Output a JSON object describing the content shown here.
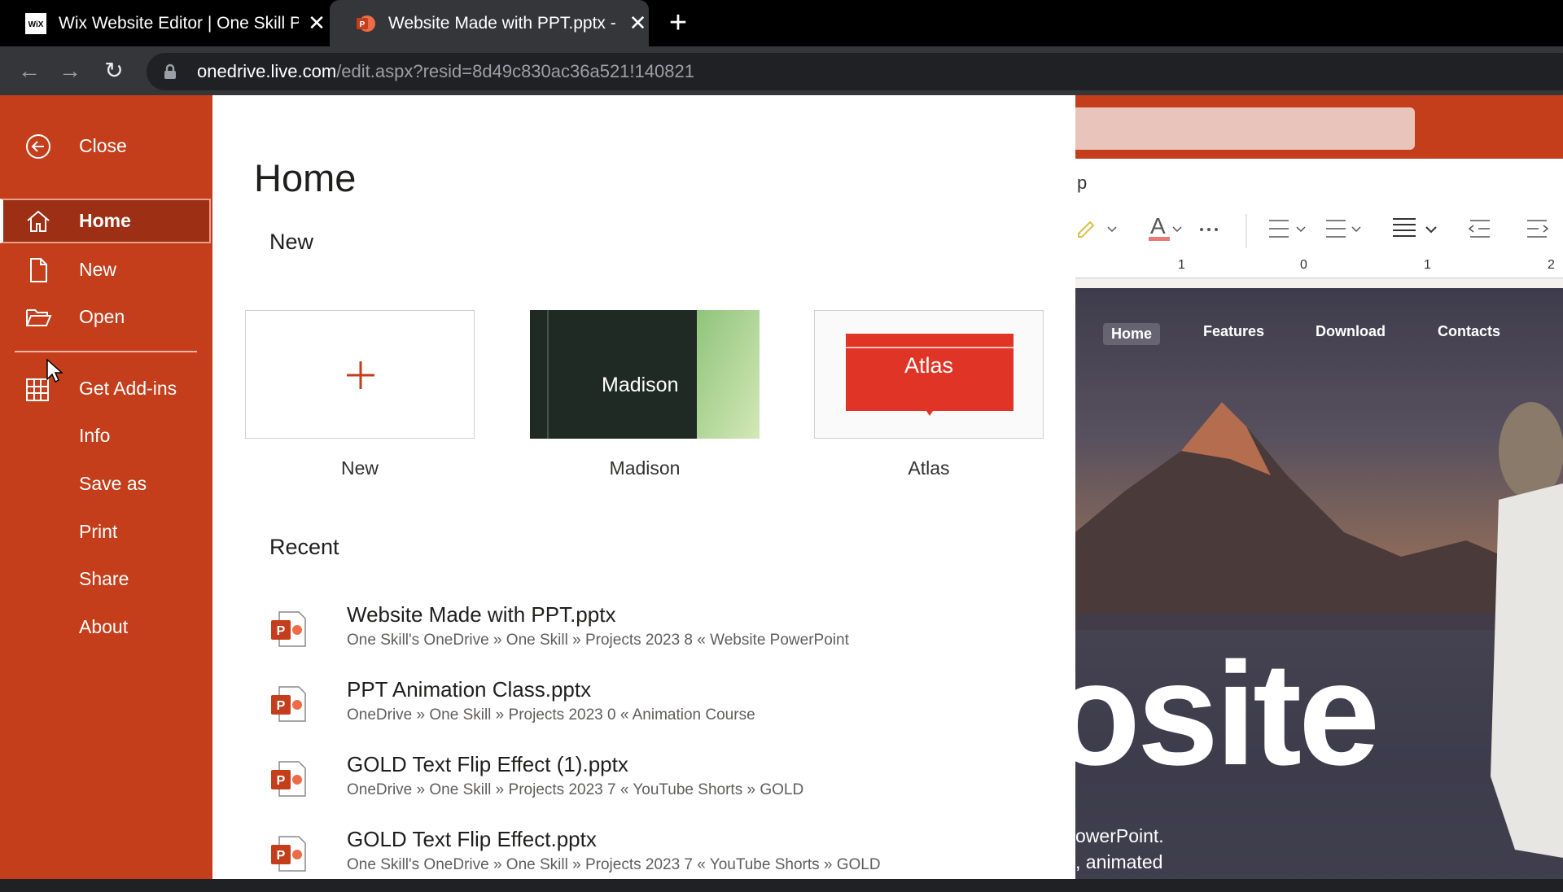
{
  "browser": {
    "tabs": [
      {
        "title": "Wix Website Editor | One Skill Po",
        "favicon": "wix-icon",
        "active": false
      },
      {
        "title": "Website Made with PPT.pptx - M",
        "favicon": "powerpoint-icon",
        "active": true
      }
    ],
    "url_host": "onedrive.live.com",
    "url_path": "/edit.aspx?resid=8d49c830ac36a521!140821"
  },
  "sidebar": {
    "close": "Close",
    "items": [
      {
        "label": "Home",
        "icon": "home-icon",
        "selected": true
      },
      {
        "label": "New",
        "icon": "new-file-icon"
      },
      {
        "label": "Open",
        "icon": "folder-open-icon"
      },
      {
        "label": "Get Add-ins",
        "icon": "add-ins-icon"
      },
      {
        "label": "Info"
      },
      {
        "label": "Save as"
      },
      {
        "label": "Print"
      },
      {
        "label": "Share"
      },
      {
        "label": "About"
      }
    ]
  },
  "home": {
    "title": "Home",
    "new_heading": "New",
    "templates": [
      {
        "label": "New",
        "thumb_text": "+"
      },
      {
        "label": "Madison",
        "thumb_text": "Madison"
      },
      {
        "label": "Atlas",
        "thumb_text": "Atlas"
      }
    ],
    "recent_heading": "Recent",
    "recent": [
      {
        "name": "Website Made with PPT.pptx",
        "path": "One Skill's OneDrive » One Skill » Projects 2023 8 « Website PowerPoint"
      },
      {
        "name": "PPT Animation Class.pptx",
        "path": "OneDrive » One Skill » Projects 2023 0 « Animation Course"
      },
      {
        "name": "GOLD Text Flip Effect (1).pptx",
        "path": "OneDrive » One Skill » Projects 2023 7 « YouTube Shorts » GOLD"
      },
      {
        "name": "GOLD Text Flip Effect.pptx",
        "path": "One Skill's OneDrive » One Skill » Projects 2023 7 « YouTube Shorts » GOLD"
      }
    ]
  },
  "editor": {
    "menu_letter": "p",
    "ruler_labels": [
      "1",
      "0",
      "1",
      "2"
    ],
    "slide_nav": [
      "Home",
      "Features",
      "Download",
      "Contacts"
    ],
    "slide_big": "osite",
    "slide_sub1": "owerPoint.",
    "slide_sub2": ", animated"
  },
  "colors": {
    "accent": "#c43e1c",
    "selected": "#9c2f14",
    "atlas_red": "#e03526",
    "madison_dark": "#1f2a25"
  }
}
